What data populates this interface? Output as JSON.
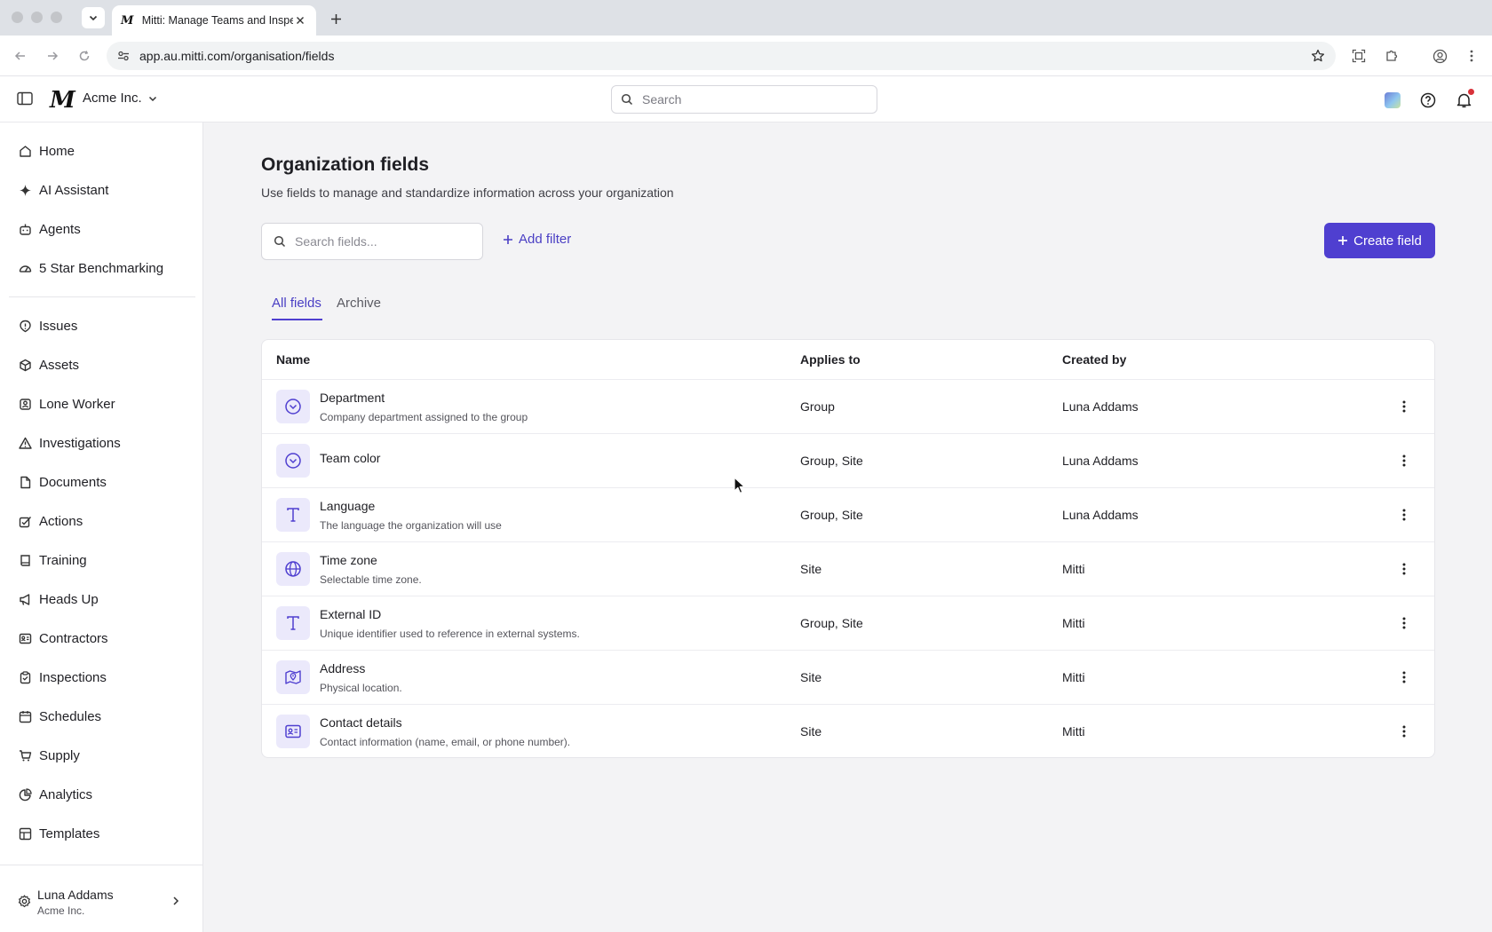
{
  "browser": {
    "tab_title": "Mitti: Manage Teams and Inspections",
    "tab_favicon": "M",
    "url": "app.au.mitti.com/organisation/fields"
  },
  "header": {
    "logo": "M",
    "org_name": "Acme Inc.",
    "search_placeholder": "Search"
  },
  "sidebar": {
    "items": [
      {
        "label": "Home",
        "icon": "home-icon"
      },
      {
        "label": "AI Assistant",
        "icon": "sparkle-icon"
      },
      {
        "label": "Agents",
        "icon": "robot-icon"
      },
      {
        "label": "5 Star Benchmarking",
        "icon": "gauge-icon"
      },
      {
        "label": "Issues",
        "icon": "alert-icon"
      },
      {
        "label": "Assets",
        "icon": "cube-icon"
      },
      {
        "label": "Lone Worker",
        "icon": "person-icon"
      },
      {
        "label": "Investigations",
        "icon": "warning-icon"
      },
      {
        "label": "Documents",
        "icon": "document-icon"
      },
      {
        "label": "Actions",
        "icon": "check-square-icon"
      },
      {
        "label": "Training",
        "icon": "book-icon"
      },
      {
        "label": "Heads Up",
        "icon": "megaphone-icon"
      },
      {
        "label": "Contractors",
        "icon": "id-card-icon"
      },
      {
        "label": "Inspections",
        "icon": "clipboard-icon"
      },
      {
        "label": "Schedules",
        "icon": "calendar-icon"
      },
      {
        "label": "Supply",
        "icon": "cart-icon"
      },
      {
        "label": "Analytics",
        "icon": "pie-chart-icon"
      },
      {
        "label": "Templates",
        "icon": "grid-icon"
      }
    ],
    "user": {
      "name": "Luna Addams",
      "org": "Acme Inc."
    }
  },
  "main": {
    "title": "Organization fields",
    "subtitle": "Use fields to manage and standardize information across your organization",
    "search_placeholder": "Search fields...",
    "add_filter_label": "Add filter",
    "create_button_label": "Create field",
    "tabs": [
      {
        "label": "All fields",
        "active": true
      },
      {
        "label": "Archive",
        "active": false
      }
    ],
    "table": {
      "columns": [
        "Name",
        "Applies to",
        "Created by"
      ],
      "rows": [
        {
          "name": "Department",
          "description": "Company department assigned to the group",
          "applies_to": "Group",
          "created_by": "Luna Addams",
          "icon": "dropdown-icon"
        },
        {
          "name": "Team color",
          "description": "",
          "applies_to": "Group, Site",
          "created_by": "Luna Addams",
          "icon": "dropdown-icon"
        },
        {
          "name": "Language",
          "description": "The language the organization will use",
          "applies_to": "Group, Site",
          "created_by": "Luna Addams",
          "icon": "text-icon"
        },
        {
          "name": "Time zone",
          "description": "Selectable time zone.",
          "applies_to": "Site",
          "created_by": "Mitti",
          "icon": "globe-icon"
        },
        {
          "name": "External ID",
          "description": "Unique identifier used to reference in external systems.",
          "applies_to": "Group, Site",
          "created_by": "Mitti",
          "icon": "text-icon"
        },
        {
          "name": "Address",
          "description": "Physical location.",
          "applies_to": "Site",
          "created_by": "Mitti",
          "icon": "map-pin-icon"
        },
        {
          "name": "Contact details",
          "description": "Contact information (name, email, or phone number).",
          "applies_to": "Site",
          "created_by": "Mitti",
          "icon": "contact-card-icon"
        }
      ]
    }
  },
  "colors": {
    "accent": "#4f3fd0",
    "accent_text": "#4a3fc4",
    "icon_bg": "#ebe9fb",
    "notification": "#d8323a"
  }
}
